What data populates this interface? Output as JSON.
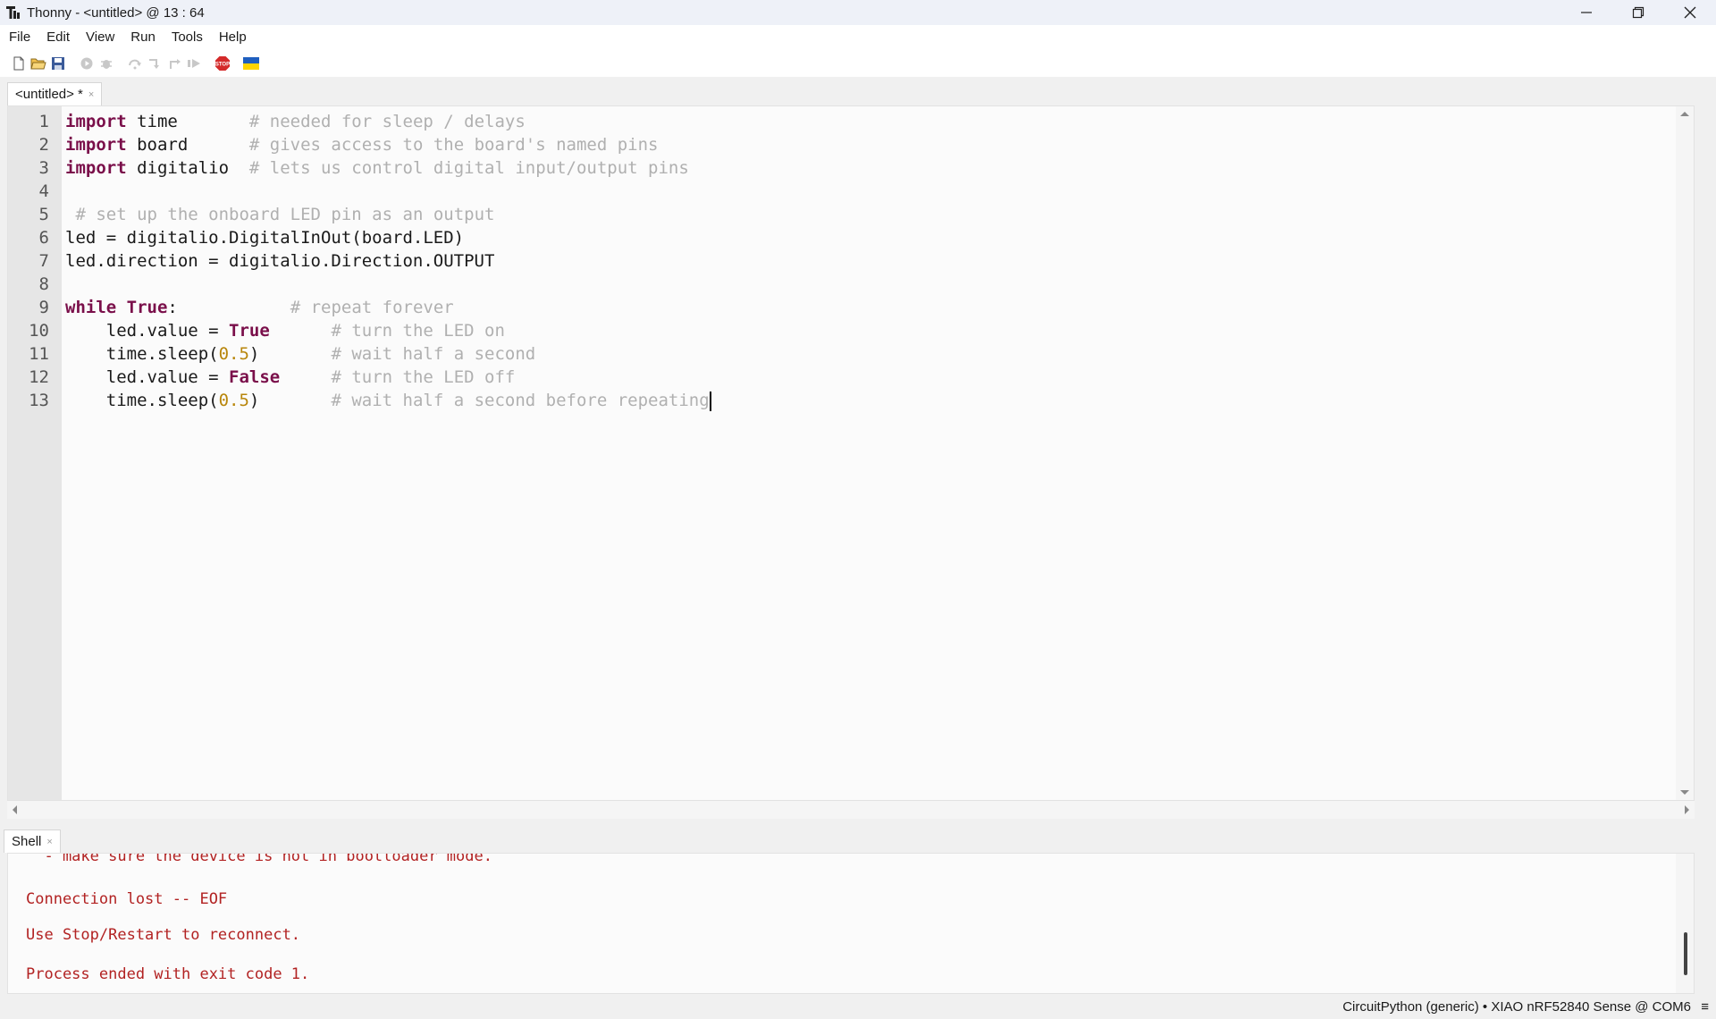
{
  "window": {
    "title": "Thonny  -  <untitled>  @  13 : 64"
  },
  "menu": [
    "File",
    "Edit",
    "View",
    "Run",
    "Tools",
    "Help"
  ],
  "toolbar": {
    "icons": [
      "new-file-icon",
      "open-file-icon",
      "save-icon",
      "run-icon",
      "debug-icon",
      "step-over-icon",
      "step-into-icon",
      "step-out-icon",
      "resume-icon",
      "stop-icon",
      "ukraine-flag-icon"
    ],
    "stop_label": "STOP"
  },
  "editor_tab": {
    "label": "<untitled> *",
    "close": "×"
  },
  "code": {
    "line_numbers": [
      "1",
      "2",
      "3",
      "4",
      "5",
      "6",
      "7",
      "8",
      "9",
      "10",
      "11",
      "12",
      "13"
    ],
    "lines": [
      [
        {
          "t": "import",
          "c": "kw"
        },
        {
          "t": " time       "
        },
        {
          "t": "# needed for sleep / delays",
          "c": "cm"
        }
      ],
      [
        {
          "t": "import",
          "c": "kw"
        },
        {
          "t": " board      "
        },
        {
          "t": "# gives access to the board's named pins",
          "c": "cm"
        }
      ],
      [
        {
          "t": "import",
          "c": "kw"
        },
        {
          "t": " digitalio  "
        },
        {
          "t": "# lets us control digital input/output pins",
          "c": "cm"
        }
      ],
      [],
      [
        {
          "t": " "
        },
        {
          "t": "# set up the onboard LED pin as an output",
          "c": "cm"
        }
      ],
      [
        {
          "t": "led = digitalio.DigitalInOut(board.LED)"
        }
      ],
      [
        {
          "t": "led.direction = digitalio.Direction.OUTPUT"
        }
      ],
      [],
      [
        {
          "t": "while",
          "c": "kw"
        },
        {
          "t": " "
        },
        {
          "t": "True",
          "c": "kw"
        },
        {
          "t": ":           "
        },
        {
          "t": "# repeat forever",
          "c": "cm"
        }
      ],
      [
        {
          "t": "    led.value = "
        },
        {
          "t": "True",
          "c": "kw"
        },
        {
          "t": "      "
        },
        {
          "t": "# turn the LED on",
          "c": "cm"
        }
      ],
      [
        {
          "t": "    time.sleep("
        },
        {
          "t": "0.5",
          "c": "num"
        },
        {
          "t": ")       "
        },
        {
          "t": "# wait half a second",
          "c": "cm"
        }
      ],
      [
        {
          "t": "    led.value = "
        },
        {
          "t": "False",
          "c": "kw"
        },
        {
          "t": "     "
        },
        {
          "t": "# turn the LED off",
          "c": "cm"
        }
      ],
      [
        {
          "t": "    time.sleep("
        },
        {
          "t": "0.5",
          "c": "num"
        },
        {
          "t": ")       "
        },
        {
          "t": "# wait half a second before repeating",
          "c": "cm"
        }
      ]
    ]
  },
  "shell_tab": {
    "label": "Shell",
    "close": "×"
  },
  "shell": {
    "lines": [
      "  - make sure the device is not in bootloader mode.",
      "Connection lost -- EOF",
      "Use Stop/Restart to reconnect.",
      "Process ended with exit code 1."
    ]
  },
  "status": {
    "interpreter": "CircuitPython (generic)  •  XIAO nRF52840 Sense @ COM6",
    "menu_glyph": "≡"
  },
  "colors": {
    "keyword": "#7a0f4a",
    "comment": "#b0b0b0",
    "number": "#b8860b",
    "shell_error": "#b22222"
  }
}
